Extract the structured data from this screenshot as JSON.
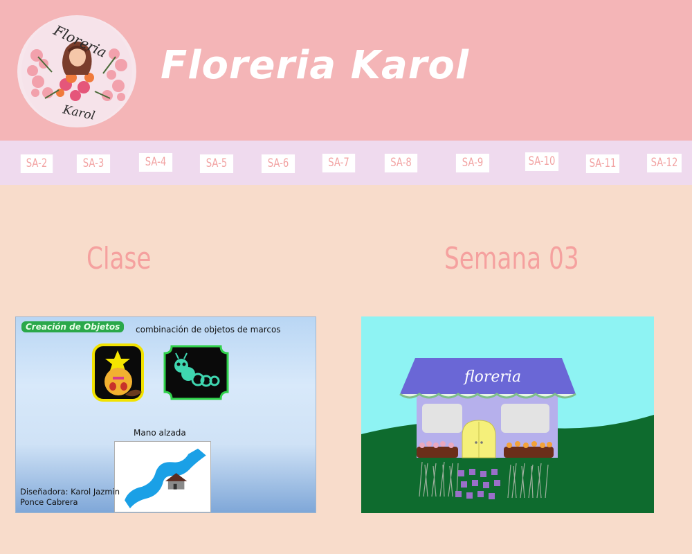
{
  "header": {
    "logo": {
      "top_text": "Floreria",
      "bottom_text": "Karol"
    },
    "title": "Floreria Karol"
  },
  "nav": {
    "items": [
      {
        "label": "SA-2"
      },
      {
        "label": "SA-3"
      },
      {
        "label": "SA-4"
      },
      {
        "label": "SA-5"
      },
      {
        "label": "SA-6"
      },
      {
        "label": "SA-7"
      },
      {
        "label": "SA-8"
      },
      {
        "label": "SA-9"
      },
      {
        "label": "SA-10"
      },
      {
        "label": "SA-11"
      },
      {
        "label": "SA-12"
      }
    ]
  },
  "main": {
    "left_heading": "Clase",
    "right_heading": "Semana 03",
    "class_slide": {
      "badge": "Creación de Objetos",
      "combo_label": "combinación de objetos de marcos",
      "hand_label": "Mano alzada",
      "designer_line1": "Diseñadora: Karol Jazmin",
      "designer_line2": "Ponce Cabrera"
    },
    "shop_image": {
      "sign_text": "floreria"
    }
  },
  "colors": {
    "header_bg": "#f4b5b7",
    "nav_bg": "#efdaee",
    "page_bg": "#f8dccb",
    "accent_text": "#f5a19f",
    "nav_text": "#f2a3a3"
  }
}
